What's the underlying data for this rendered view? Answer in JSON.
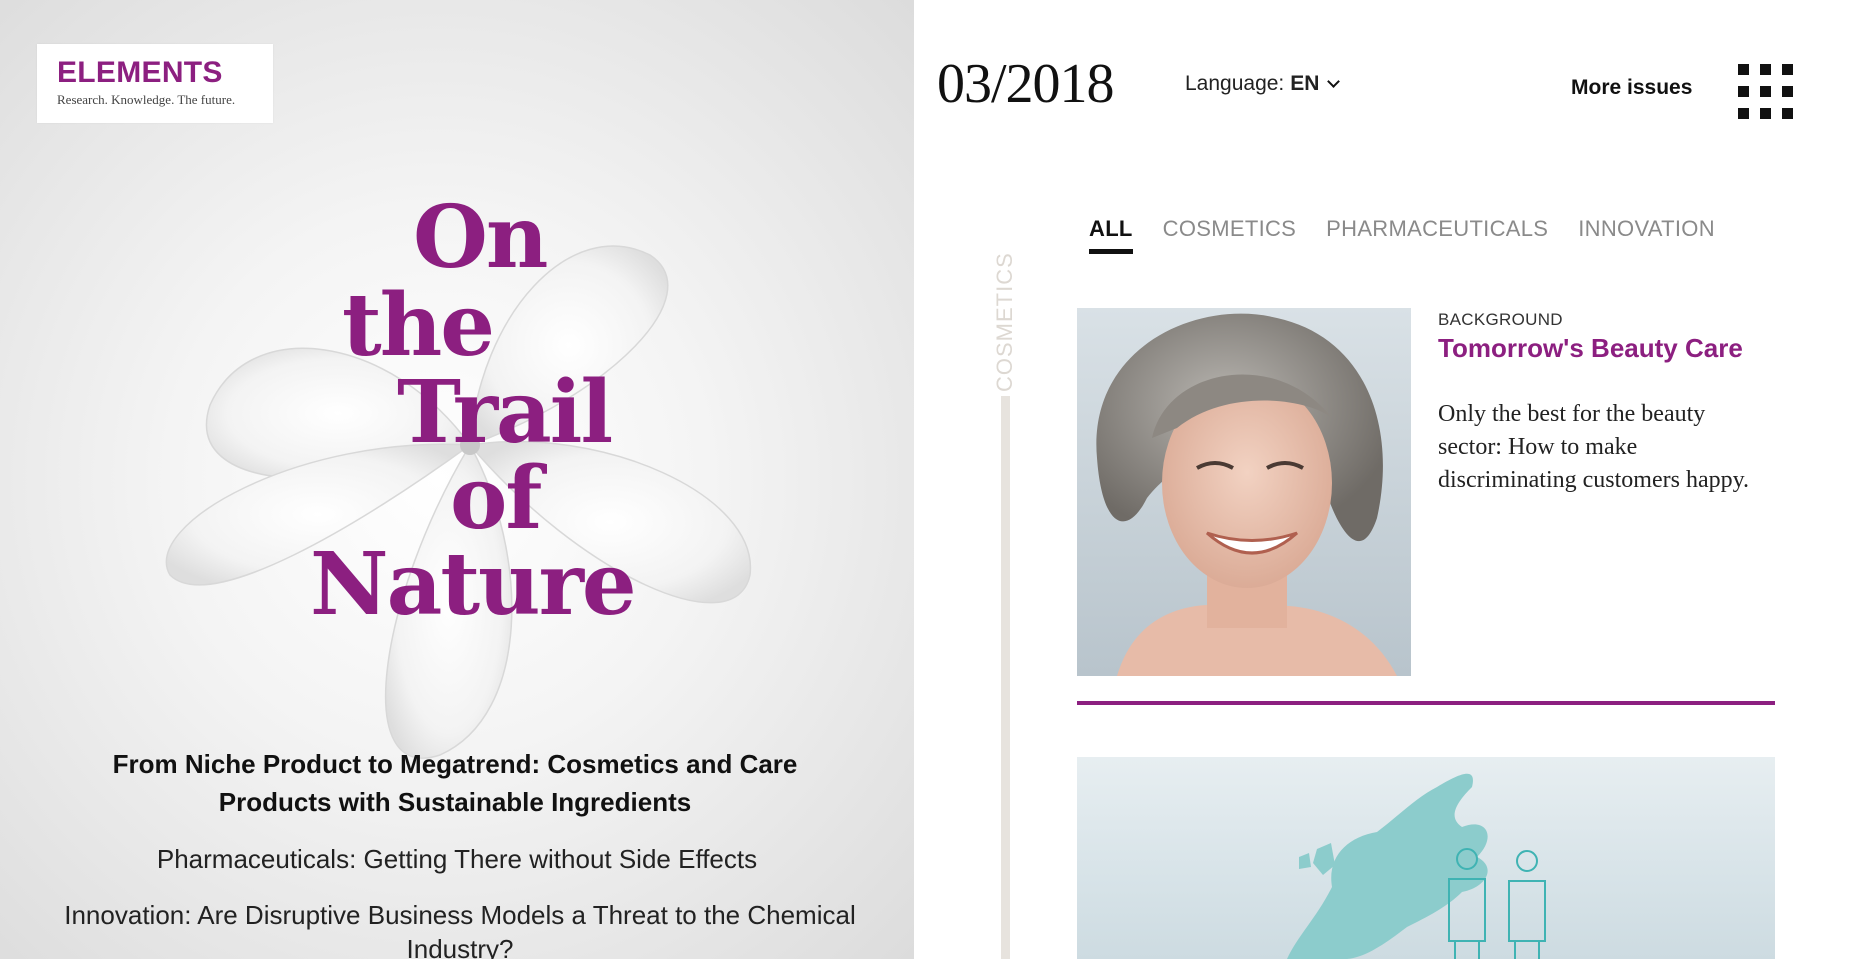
{
  "logo": {
    "title": "ELEMENTS",
    "subtitle": "Research. Knowledge. The future."
  },
  "cover": {
    "headline": [
      "On",
      "the",
      "Trail",
      "of",
      "Nature"
    ],
    "lead": "From Niche Product to Megatrend: Cosmetics and Care Products with Sustainable Ingredients",
    "line1": "Pharmaceuticals: Getting There without Side Effects",
    "line2": "Innovation: Are Disruptive Business Models a Threat to the Chemical Industry?"
  },
  "header": {
    "issue": "03/2018",
    "language_label": "Language:",
    "language_value": "EN",
    "more_issues": "More issues"
  },
  "tabs": [
    {
      "label": "ALL",
      "active": true
    },
    {
      "label": "COSMETICS",
      "active": false
    },
    {
      "label": "PHARMACEUTICALS",
      "active": false
    },
    {
      "label": "INNOVATION",
      "active": false
    }
  ],
  "rail_label": "COSMETICS",
  "article": {
    "kicker": "BACKGROUND",
    "title": "Tomorrow's Beauty Care",
    "teaser": "Only the best for the beauty sector: How to make discriminating customers happy."
  },
  "colors": {
    "brand": "#8c1f80",
    "rail": "#e7e3de",
    "map": "#8ccccc"
  }
}
